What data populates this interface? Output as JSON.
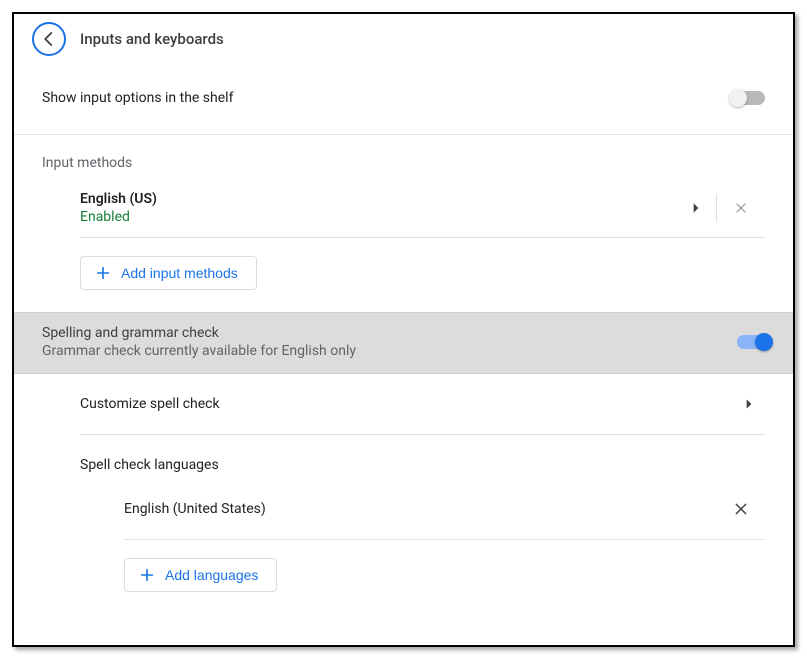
{
  "header": {
    "title": "Inputs and keyboards"
  },
  "shelf_option": {
    "label": "Show input options in the shelf",
    "enabled": false
  },
  "input_methods": {
    "heading": "Input methods",
    "items": [
      {
        "name": "English (US)",
        "status": "Enabled"
      }
    ],
    "add_label": "Add input methods"
  },
  "spell": {
    "title": "Spelling and grammar check",
    "subtitle": "Grammar check currently available for English only",
    "enabled": true,
    "customize_label": "Customize spell check",
    "languages_heading": "Spell check languages",
    "languages": [
      {
        "name": "English (United States)"
      }
    ],
    "add_label": "Add languages"
  }
}
